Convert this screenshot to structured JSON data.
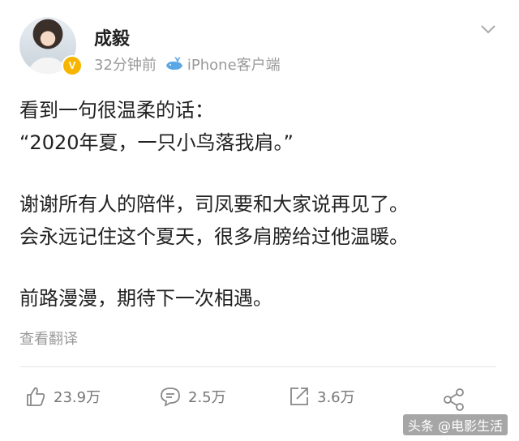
{
  "post": {
    "author": "成毅",
    "verified_badge": "V",
    "time": "32分钟前",
    "source": "iPhone客户端",
    "lines": [
      "看到一句很温柔的话：",
      "“2020年夏，一只小鸟落我肩。”",
      "",
      "谢谢所有人的陪伴，司凤要和大家说再见了。",
      "会永远记住这个夏天，很多肩膀给过他温暖。",
      "",
      "前路漫漫，期待下一次相遇。"
    ],
    "translate_label": "查看翻译"
  },
  "actions": {
    "like_count": "23.9万",
    "comment_count": "2.5万",
    "repost_count": "3.6万"
  },
  "icons": [
    "chevron-down-icon",
    "whale-icon",
    "thumbs-up-icon",
    "comment-icon",
    "repost-icon",
    "share-icon"
  ],
  "watermark": "头条 @电影生活",
  "colors": {
    "text": "#222222",
    "meta": "#9a9a9a",
    "badge": "#f7b500"
  }
}
